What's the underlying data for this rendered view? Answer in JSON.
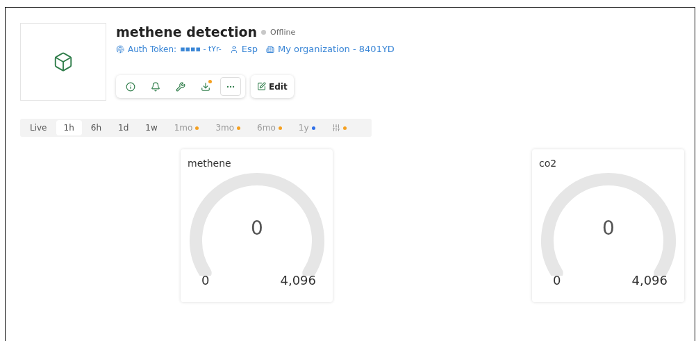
{
  "device": {
    "title": "methene detection",
    "status": "Offline",
    "meta": [
      {
        "kind": "token",
        "label": "Auth Token:",
        "value": "▪▪▪▪ - tYr-"
      },
      {
        "kind": "user",
        "value": "Esp"
      },
      {
        "kind": "org",
        "value": "My organization - 8401YD"
      }
    ]
  },
  "toolbar": [
    {
      "kind": "info",
      "selected": false,
      "badge": false
    },
    {
      "kind": "bell",
      "selected": false,
      "badge": false
    },
    {
      "kind": "tool",
      "selected": false,
      "badge": false
    },
    {
      "kind": "download",
      "selected": false,
      "badge": true
    },
    {
      "kind": "more",
      "selected": true,
      "badge": false
    }
  ],
  "edit_button": {
    "label": "Edit"
  },
  "time_tabs": [
    {
      "kind": "text",
      "label": "Live",
      "selected": false
    },
    {
      "kind": "text",
      "label": "1h",
      "selected": true
    },
    {
      "kind": "text",
      "label": "6h",
      "selected": false
    },
    {
      "kind": "text",
      "label": "1d",
      "selected": false
    },
    {
      "kind": "text",
      "label": "1w",
      "selected": false
    },
    {
      "kind": "text",
      "label": "1mo",
      "selected": false,
      "color": "#f5a020"
    },
    {
      "kind": "text",
      "label": "3mo",
      "selected": false,
      "color": "#f5a020"
    },
    {
      "kind": "text",
      "label": "6mo",
      "selected": false,
      "color": "#f5a020"
    },
    {
      "kind": "text",
      "label": "1y",
      "selected": false,
      "color": "#2f6fe8"
    },
    {
      "kind": "icon",
      "selected": false,
      "color": "#f5a020"
    }
  ],
  "gauges": [
    {
      "title": "methene",
      "value": "0",
      "min": "0",
      "max": "4,096"
    },
    {
      "title": "co2",
      "value": "0",
      "min": "0",
      "max": "4,096"
    }
  ]
}
